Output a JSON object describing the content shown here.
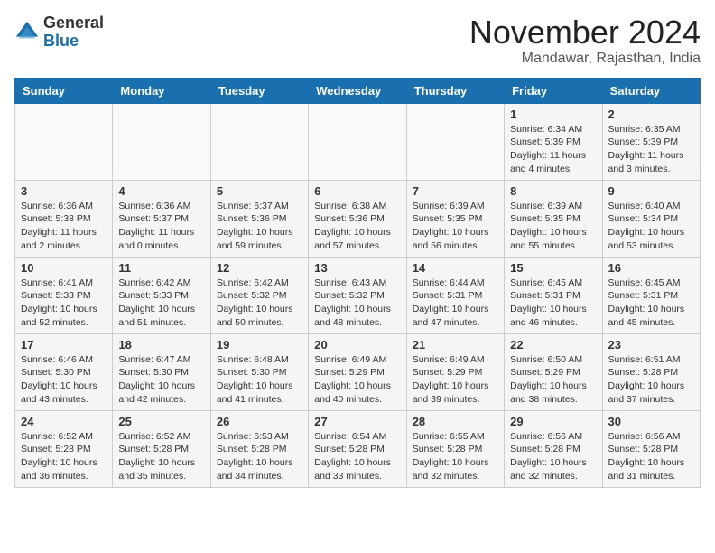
{
  "header": {
    "logo_line1": "General",
    "logo_line2": "Blue",
    "month": "November 2024",
    "location": "Mandawar, Rajasthan, India"
  },
  "days_of_week": [
    "Sunday",
    "Monday",
    "Tuesday",
    "Wednesday",
    "Thursday",
    "Friday",
    "Saturday"
  ],
  "weeks": [
    [
      {
        "day": "",
        "info": ""
      },
      {
        "day": "",
        "info": ""
      },
      {
        "day": "",
        "info": ""
      },
      {
        "day": "",
        "info": ""
      },
      {
        "day": "",
        "info": ""
      },
      {
        "day": "1",
        "info": "Sunrise: 6:34 AM\nSunset: 5:39 PM\nDaylight: 11 hours and 4 minutes."
      },
      {
        "day": "2",
        "info": "Sunrise: 6:35 AM\nSunset: 5:39 PM\nDaylight: 11 hours and 3 minutes."
      }
    ],
    [
      {
        "day": "3",
        "info": "Sunrise: 6:36 AM\nSunset: 5:38 PM\nDaylight: 11 hours and 2 minutes."
      },
      {
        "day": "4",
        "info": "Sunrise: 6:36 AM\nSunset: 5:37 PM\nDaylight: 11 hours and 0 minutes."
      },
      {
        "day": "5",
        "info": "Sunrise: 6:37 AM\nSunset: 5:36 PM\nDaylight: 10 hours and 59 minutes."
      },
      {
        "day": "6",
        "info": "Sunrise: 6:38 AM\nSunset: 5:36 PM\nDaylight: 10 hours and 57 minutes."
      },
      {
        "day": "7",
        "info": "Sunrise: 6:39 AM\nSunset: 5:35 PM\nDaylight: 10 hours and 56 minutes."
      },
      {
        "day": "8",
        "info": "Sunrise: 6:39 AM\nSunset: 5:35 PM\nDaylight: 10 hours and 55 minutes."
      },
      {
        "day": "9",
        "info": "Sunrise: 6:40 AM\nSunset: 5:34 PM\nDaylight: 10 hours and 53 minutes."
      }
    ],
    [
      {
        "day": "10",
        "info": "Sunrise: 6:41 AM\nSunset: 5:33 PM\nDaylight: 10 hours and 52 minutes."
      },
      {
        "day": "11",
        "info": "Sunrise: 6:42 AM\nSunset: 5:33 PM\nDaylight: 10 hours and 51 minutes."
      },
      {
        "day": "12",
        "info": "Sunrise: 6:42 AM\nSunset: 5:32 PM\nDaylight: 10 hours and 50 minutes."
      },
      {
        "day": "13",
        "info": "Sunrise: 6:43 AM\nSunset: 5:32 PM\nDaylight: 10 hours and 48 minutes."
      },
      {
        "day": "14",
        "info": "Sunrise: 6:44 AM\nSunset: 5:31 PM\nDaylight: 10 hours and 47 minutes."
      },
      {
        "day": "15",
        "info": "Sunrise: 6:45 AM\nSunset: 5:31 PM\nDaylight: 10 hours and 46 minutes."
      },
      {
        "day": "16",
        "info": "Sunrise: 6:45 AM\nSunset: 5:31 PM\nDaylight: 10 hours and 45 minutes."
      }
    ],
    [
      {
        "day": "17",
        "info": "Sunrise: 6:46 AM\nSunset: 5:30 PM\nDaylight: 10 hours and 43 minutes."
      },
      {
        "day": "18",
        "info": "Sunrise: 6:47 AM\nSunset: 5:30 PM\nDaylight: 10 hours and 42 minutes."
      },
      {
        "day": "19",
        "info": "Sunrise: 6:48 AM\nSunset: 5:30 PM\nDaylight: 10 hours and 41 minutes."
      },
      {
        "day": "20",
        "info": "Sunrise: 6:49 AM\nSunset: 5:29 PM\nDaylight: 10 hours and 40 minutes."
      },
      {
        "day": "21",
        "info": "Sunrise: 6:49 AM\nSunset: 5:29 PM\nDaylight: 10 hours and 39 minutes."
      },
      {
        "day": "22",
        "info": "Sunrise: 6:50 AM\nSunset: 5:29 PM\nDaylight: 10 hours and 38 minutes."
      },
      {
        "day": "23",
        "info": "Sunrise: 6:51 AM\nSunset: 5:28 PM\nDaylight: 10 hours and 37 minutes."
      }
    ],
    [
      {
        "day": "24",
        "info": "Sunrise: 6:52 AM\nSunset: 5:28 PM\nDaylight: 10 hours and 36 minutes."
      },
      {
        "day": "25",
        "info": "Sunrise: 6:52 AM\nSunset: 5:28 PM\nDaylight: 10 hours and 35 minutes."
      },
      {
        "day": "26",
        "info": "Sunrise: 6:53 AM\nSunset: 5:28 PM\nDaylight: 10 hours and 34 minutes."
      },
      {
        "day": "27",
        "info": "Sunrise: 6:54 AM\nSunset: 5:28 PM\nDaylight: 10 hours and 33 minutes."
      },
      {
        "day": "28",
        "info": "Sunrise: 6:55 AM\nSunset: 5:28 PM\nDaylight: 10 hours and 32 minutes."
      },
      {
        "day": "29",
        "info": "Sunrise: 6:56 AM\nSunset: 5:28 PM\nDaylight: 10 hours and 32 minutes."
      },
      {
        "day": "30",
        "info": "Sunrise: 6:56 AM\nSunset: 5:28 PM\nDaylight: 10 hours and 31 minutes."
      }
    ]
  ]
}
